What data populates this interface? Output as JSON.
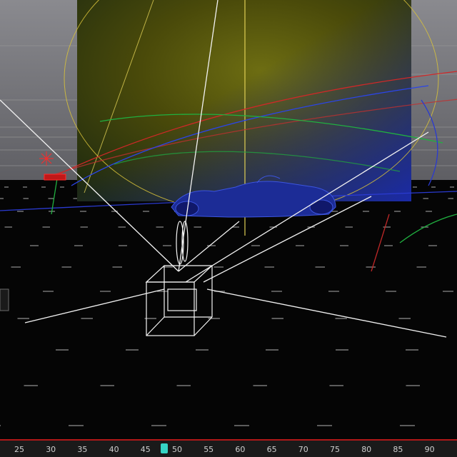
{
  "app": {
    "view": "3D perspective viewport",
    "background_color": "#000000",
    "accent_color": "#36d3c4",
    "timeline_marker_color": "#b01818"
  },
  "viewport": {
    "objects": [
      {
        "name": "rear backdrop plane",
        "colors": [
          "#2e2e00",
          "#6a6a10",
          "#1f2aa8"
        ]
      },
      {
        "name": "race car model",
        "color": "#2233aa"
      },
      {
        "name": "camera frustum wireframe",
        "color": "#ffffff"
      },
      {
        "name": "light target",
        "color": "#ff2020"
      },
      {
        "name": "motion path curves",
        "colors": [
          "#ff3030",
          "#20c040",
          "#3050ff"
        ]
      }
    ]
  },
  "timeline": {
    "current_frame": 48,
    "ticks": [
      "25",
      "30",
      "35",
      "40",
      "45",
      "50",
      "55",
      "60",
      "65",
      "70",
      "75",
      "80",
      "85",
      "90"
    ]
  }
}
